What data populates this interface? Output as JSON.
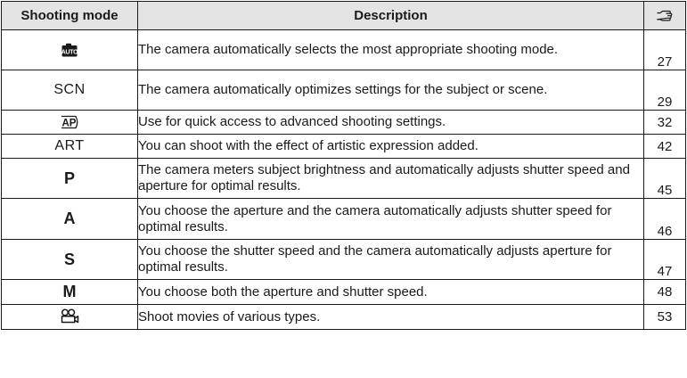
{
  "table": {
    "headers": {
      "mode": "Shooting mode",
      "description": "Description",
      "page_icon": "reference-hand-icon"
    },
    "rows": [
      {
        "mode_icon": "auto-mode-icon",
        "mode": "",
        "description": "The camera automatically selects the most appropriate shooting mode.",
        "page": "27"
      },
      {
        "mode_icon": "",
        "mode": "SCN",
        "description": "The camera automatically optimizes settings for the subject or scene.",
        "page": "29"
      },
      {
        "mode_icon": "ap-mode-icon",
        "mode": "",
        "description": "Use for quick access to advanced shooting settings.",
        "page": "32"
      },
      {
        "mode_icon": "",
        "mode": "ART",
        "description": "You can shoot with the effect of artistic expression added.",
        "page": "42"
      },
      {
        "mode_icon": "",
        "mode": "P",
        "description": "The camera meters subject brightness and automatically adjusts shutter speed and aperture for optimal results.",
        "page": "45"
      },
      {
        "mode_icon": "",
        "mode": "A",
        "description": "You choose the aperture and the camera automatically adjusts shutter speed for optimal results.",
        "page": "46"
      },
      {
        "mode_icon": "",
        "mode": "S",
        "description": "You choose the shutter speed and the camera automatically adjusts aperture for optimal results.",
        "page": "47"
      },
      {
        "mode_icon": "",
        "mode": "M",
        "description": "You choose both the aperture and shutter speed.",
        "page": "48"
      },
      {
        "mode_icon": "movie-mode-icon",
        "mode": "",
        "description": "Shoot movies of various types.",
        "page": "53"
      }
    ]
  },
  "colors": {
    "header_background": "#e4e4e4",
    "border": "#1a1a1a",
    "text": "#1a1a1a"
  }
}
